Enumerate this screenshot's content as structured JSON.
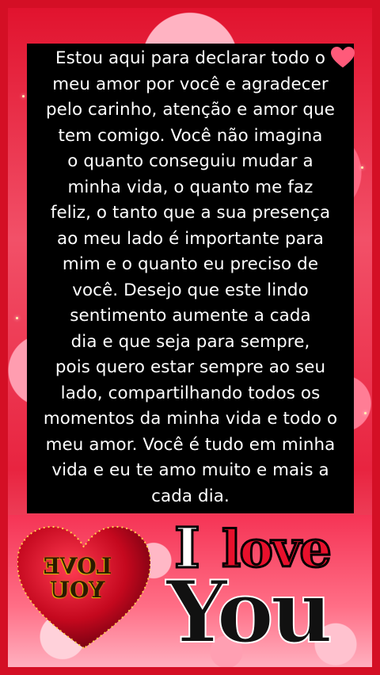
{
  "message": {
    "text": "Estou aqui para declarar todo o\nmeu amor por você e agradecer\npelo carinho, atenção e amor que\ntem comigo. Você não imagina\no quanto conseguiu mudar a\nminha vida, o quanto me faz\nfeliz, o tanto que a sua presença\nao meu lado é importante para\nmim e o quanto eu preciso de\nvocê. Desejo que este lindo\nsentimento aumente a cada\ndia e que seja para sempre,\npois quero estar sempre ao seu\nlado, compartilhando todos os\nmomentos da minha vida e todo o\nmeu amor. Você é tudo em minha\nvida e eu te amo muito e mais a\ncada dia."
  },
  "artwork": {
    "heart_text": "LOVE\nYOU",
    "logo_i": "I",
    "logo_love": "love",
    "logo_you": "You"
  },
  "colors": {
    "frame": "#d40f25",
    "message_bg": "#000000",
    "message_text": "#ffffff",
    "heart": "#c4081e",
    "logo_love": "#e8102c"
  }
}
